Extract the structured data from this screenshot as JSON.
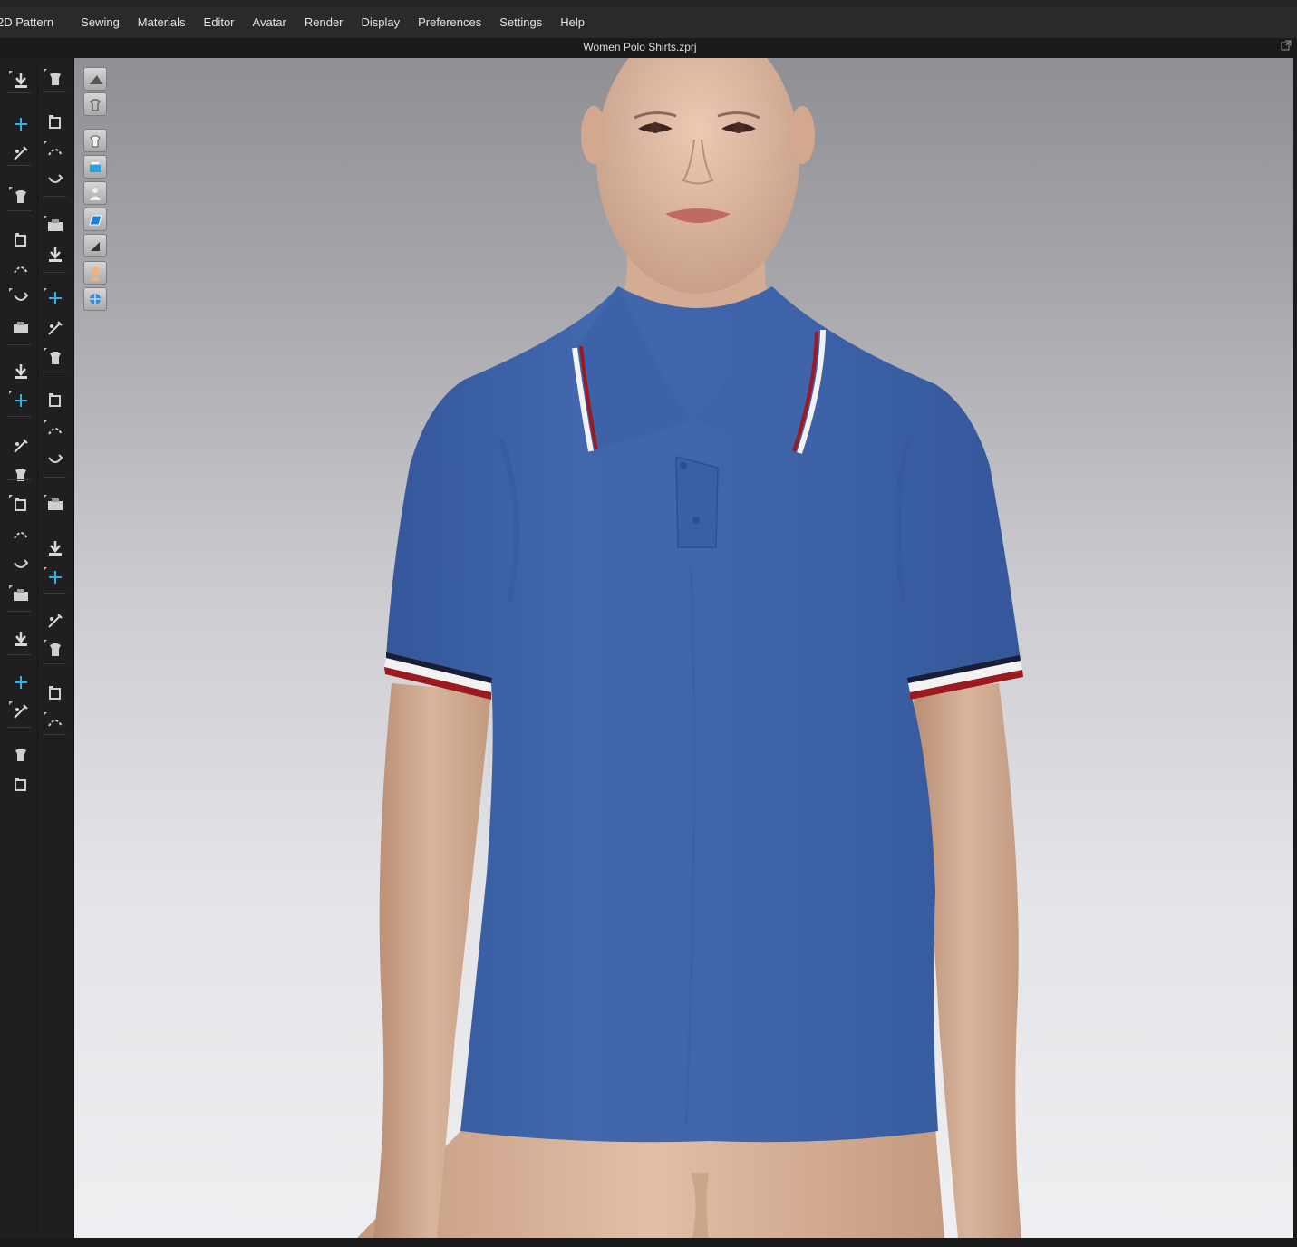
{
  "menu": {
    "items": [
      "2D Pattern",
      "Sewing",
      "Materials",
      "Editor",
      "Avatar",
      "Render",
      "Display",
      "Preferences",
      "Settings",
      "Help"
    ]
  },
  "window": {
    "title": "Women Polo Shirts.zprj"
  },
  "toolbar": {
    "left_column": [
      "simulation-icon",
      "add-point-icon",
      "edit-curvature-icon",
      "garment-fit-icon",
      "transform-pattern-icon",
      "segment-sewing-icon",
      "free-sewing-icon",
      "fold-arrangement-icon",
      "pin-icon",
      "tack-icon",
      "fabric-tool-icon",
      "puckering-icon",
      "shirring-icon",
      "shrinkwrap-icon",
      "avatar-measure-icon",
      "body-icon",
      "layer-icon",
      "tape-measure-icon",
      "ruler-icon",
      "strengthen-icon",
      "fit-map-icon"
    ],
    "right_column": [
      "walk-pose-icon",
      "select-move-icon",
      "edit-pattern-icon",
      "cut-pattern-icon",
      "trace-icon",
      "straight-line-icon",
      "gather-icon",
      "texture-edit-icon",
      "graphic-icon",
      "button-icon",
      "select-button-icon",
      "buttonhole-icon",
      "zipper-icon",
      "trim-icon",
      "puckering-brush-icon",
      "fold-brush-icon",
      "piping-icon",
      "flatten-icon",
      "elastic-icon"
    ]
  },
  "view_toolbar": {
    "buttons": [
      "avatar-view-icon",
      "garment-view-icon",
      "show-garment-icon",
      "show-pattern-icon",
      "show-avatar-icon",
      "texture-surface-icon",
      "thick-render-icon",
      "skin-icon",
      "environment-icon"
    ]
  },
  "colors": {
    "menubar": "#2a2a2c",
    "toolbar": "#1f1f21",
    "garment": "#3d63a8",
    "trim_red": "#9a1a1f",
    "trim_white": "#f2f2f2",
    "trim_navy": "#1a1d33",
    "skin": "#d9b39a",
    "viewport_top": "#909094",
    "viewport_bottom": "#efeff2"
  }
}
